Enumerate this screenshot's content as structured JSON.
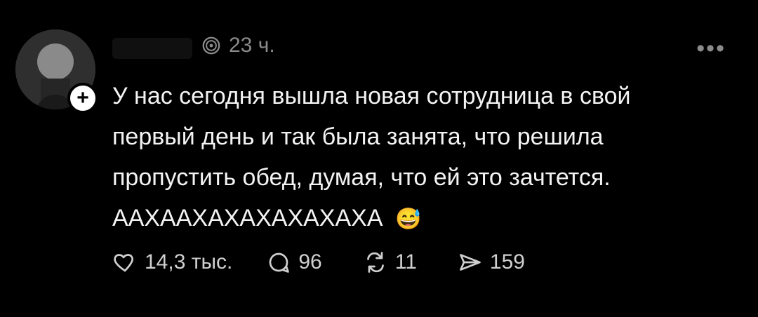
{
  "post": {
    "time": "23 ч.",
    "more_icon": "more-horizontal-icon",
    "text_lines": [
      "У нас сегодня вышла новая сотрудница в свой",
      "первый день и так была занята, что решила",
      "пропустить обед, думая, что ей это зачтется.",
      "ААХААХАХАХАХАХАХА"
    ],
    "emoji": "😅"
  },
  "actions": {
    "likes": "14,3 тыс.",
    "comments": "96",
    "reposts": "11",
    "shares": "159"
  },
  "colors": {
    "background": "#000000",
    "text": "#f3f3f3",
    "muted": "#8b8b8b"
  }
}
